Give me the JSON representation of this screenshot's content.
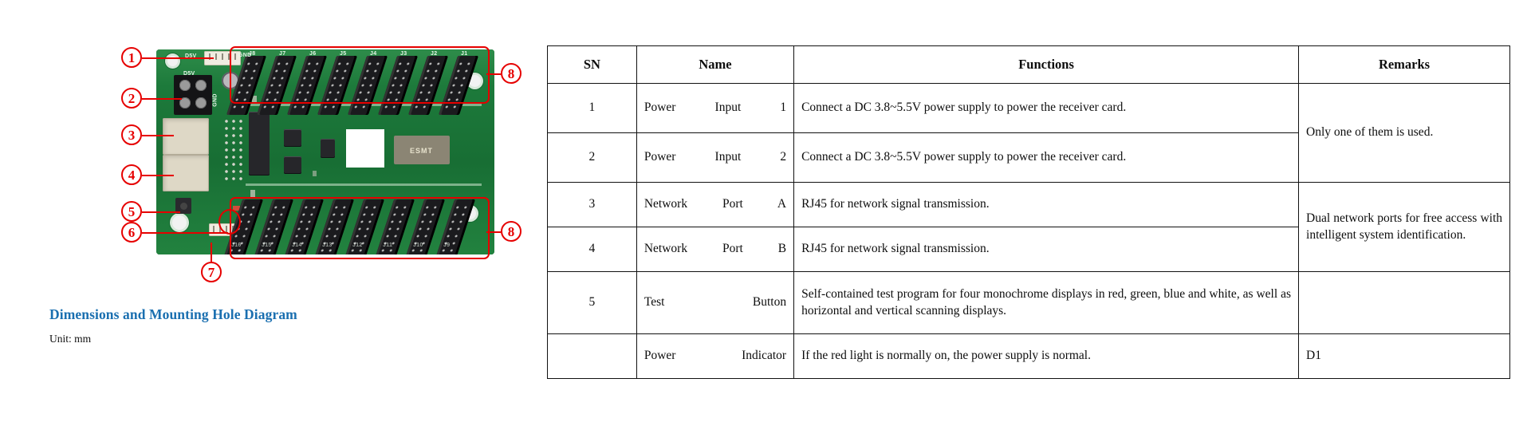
{
  "document": {
    "section_heading": "Dimensions and Mounting Hole Diagram",
    "unit_note": "Unit: mm"
  },
  "diagram": {
    "title": "receiver-card-photo",
    "callouts": [
      {
        "number": "①",
        "id": "1"
      },
      {
        "number": "②",
        "id": "2"
      },
      {
        "number": "③",
        "id": "3"
      },
      {
        "number": "④",
        "id": "4"
      },
      {
        "number": "⑤",
        "id": "5"
      },
      {
        "number": "⑥",
        "id": "6"
      },
      {
        "number": "⑦",
        "id": "7"
      },
      {
        "number": "⑧",
        "id": "8-top"
      },
      {
        "number": "⑧",
        "id": "8-bottom"
      }
    ],
    "callout_labels": {
      "one": "1",
      "two": "2",
      "three": "3",
      "four": "4",
      "five": "5",
      "six": "6",
      "seven": "7",
      "eight_top": "8",
      "eight_bottom": "8"
    },
    "silkscreen": {
      "power_top": "D5V",
      "power_bottom": "D5V",
      "gnd_top": "GND",
      "gnd_side": "GND",
      "esmt": "ESMT",
      "top_connectors": [
        "J8",
        "J7",
        "J6",
        "J5",
        "J4",
        "J3",
        "J2",
        "J1"
      ],
      "bottom_connectors": [
        "J16",
        "J15",
        "J14",
        "J13",
        "J12",
        "J11",
        "J10",
        "J9"
      ]
    },
    "colors": {
      "pcb_green": "#1d7a3b",
      "callout_red": "#e60000",
      "heading_blue": "#1a6fb0",
      "connector_black": "#1b1b1e",
      "rj45_cream": "#ded8c6"
    }
  },
  "table": {
    "headers": {
      "sn": "SN",
      "name": "Name",
      "functions": "Functions",
      "remarks": "Remarks"
    },
    "rows": [
      {
        "sn": "1",
        "name": "Power Input 1",
        "functions": "Connect a DC 3.8~5.5V power supply to power the receiver card.",
        "remarks": "Only one of them is used."
      },
      {
        "sn": "2",
        "name": "Power Input 2",
        "functions": "Connect a DC 3.8~5.5V power supply to power the receiver card.",
        "remarks": ""
      },
      {
        "sn": "3",
        "name": "Network Port A",
        "functions": "RJ45 for network signal transmission.",
        "remarks": "Dual network ports for free access with intelligent system identification."
      },
      {
        "sn": "4",
        "name": "Network Port B",
        "functions": "RJ45 for network signal transmission.",
        "remarks": ""
      },
      {
        "sn": "5",
        "name": "Test Button",
        "functions": "Self-contained test program for four monochrome displays in red, green, blue and white, as well as horizontal and vertical scanning displays.",
        "remarks": ""
      },
      {
        "sn": "",
        "name": "Power Indicator",
        "functions": "If the red light is normally on, the power supply is normal.",
        "remarks": "D1"
      }
    ]
  }
}
